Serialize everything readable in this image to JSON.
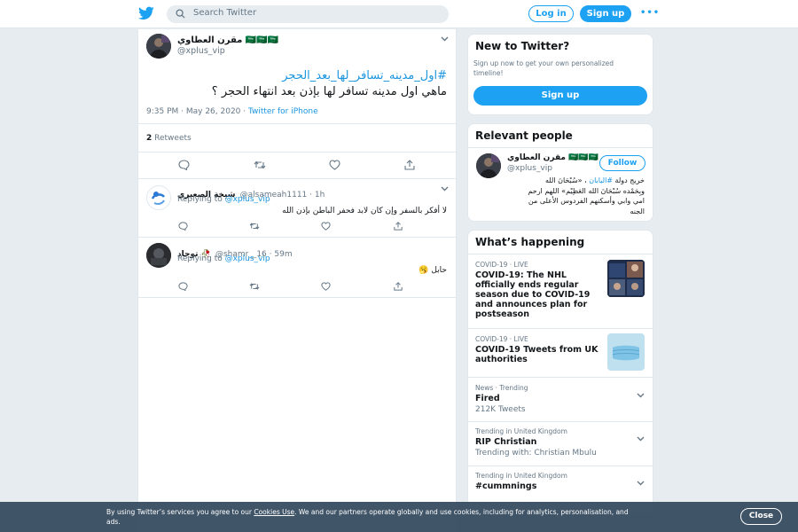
{
  "header": {
    "search_placeholder": "Search Twitter",
    "login_label": "Log in",
    "signup_label": "Sign up",
    "more_label": "•••"
  },
  "main_tweet": {
    "author_name": "مقرن العطاوي 🇸🇦🇸🇦🇸🇦",
    "author_handle": "@xplus_vip",
    "hashtag": "#اول_مدينه_تسافر_لها_بعد_الحجر",
    "text": "ماهي اول مدينه تسافر لها بإذن بعد انتهاء الحجر ؟",
    "time": "9:35 PM · May 26, 2020 · ",
    "source": "Twitter for iPhone",
    "retweet_count": "2",
    "retweet_label": "Retweets"
  },
  "replies": [
    {
      "name": "شيخة الصعيري",
      "handle": "@alsameah1111 · 1h",
      "replying_prefix": "Replying to ",
      "replying_to": "@xplus_vip",
      "text": "لا أفكر بالسفر وإن كان لابد فحفر الباطن بإذن الله"
    },
    {
      "name": "توجاد 🥀",
      "handle": "@shamr__16 · 59m",
      "replying_prefix": "Replying to ",
      "replying_to": "@xplus_vip",
      "text": "حابل 🥱"
    }
  ],
  "new_to_twitter": {
    "title": "New to Twitter?",
    "text": "Sign up now to get your own personalized timeline!",
    "button": "Sign up"
  },
  "relevant_people": {
    "title": "Relevant people",
    "name": "مقرن العطاوي 🇸🇦🇸🇦🇸🇦",
    "handle": "@xplus_vip",
    "follow_label": "Follow",
    "bio_line1_prefix": "خريج دولة ",
    "bio_line1_tag": "#اليابان",
    "bio_line1_suffix": " ، «سُبْحَانَ الله",
    "bio_line2": "وبِحَمْده سُبْحَانَ الله العَظِيْم» اللهم ارحم",
    "bio_line3": "امي وابي وأسكنهم الفردوس الأعلى من",
    "bio_line4": "الجنه"
  },
  "whats_happening": {
    "title": "What’s happening",
    "items": [
      {
        "meta": "COVID-19 · LIVE",
        "title": "COVID-19: The NHL officially ends regular season due to COVID-19 and announces plan for postseason",
        "sub": ""
      },
      {
        "meta": "COVID-19 · LIVE",
        "title": "COVID-19 Tweets from UK authorities",
        "sub": ""
      },
      {
        "meta": "News · Trending",
        "title": "Fired",
        "sub": "212K Tweets"
      },
      {
        "meta": "Trending in United Kingdom",
        "title": "RIP Christian",
        "sub": "Trending with: Christian Mbulu"
      },
      {
        "meta": "Trending in United Kingdom",
        "title": "#cummnings",
        "sub": ""
      }
    ]
  },
  "cookie_banner": {
    "text_before": "By using Twitter’s services you agree to our ",
    "link": "Cookies Use",
    "text_after": ". We and our partners operate globally and use cookies, including for analytics, personalisation, and ads.",
    "close_label": "Close"
  },
  "colors": {
    "brand": "#1da1f2",
    "link": "#1b95e0",
    "background": "#e6ecf0"
  }
}
